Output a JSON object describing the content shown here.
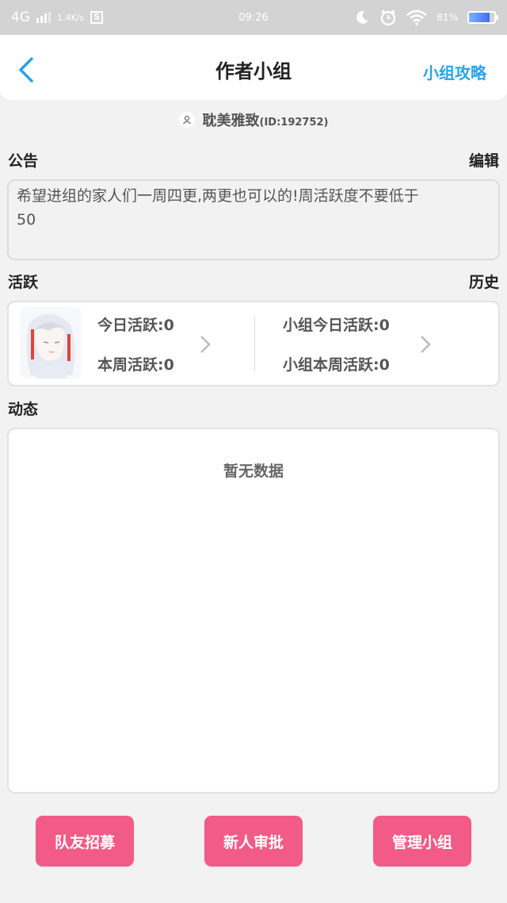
{
  "status_bar": {
    "network": "4G",
    "speed": "1.4K/s",
    "s_icon_letter": "S",
    "time": "09:26",
    "battery_percent": "81%",
    "battery_level": 0.81
  },
  "header": {
    "title": "作者小组",
    "right_link": "小组攻略"
  },
  "group": {
    "name": "耽美雅致",
    "id_text": "(ID:192752)"
  },
  "notice": {
    "label": "公告",
    "edit_label": "编辑",
    "line1": "希望进组的家人们一周四更,两更也可以的!周活跃度不要低于",
    "line2": "50"
  },
  "activity": {
    "label": "活跃",
    "history_label": "历史",
    "today": "今日活跃:0",
    "week": "本周活跃:0",
    "group_today": "小组今日活跃:0",
    "group_week": "小组本周活跃:0"
  },
  "feed": {
    "label": "动态",
    "empty_text": "暂无数据"
  },
  "buttons": {
    "recruit": "队友招募",
    "approve": "新人审批",
    "manage": "管理小组"
  },
  "colors": {
    "accent_blue": "#29a3e6",
    "button_pink": "#f25b87"
  },
  "icons": {
    "back": "chevron-left-icon",
    "group": "user-icon",
    "chevron": "chevron-right-icon"
  }
}
